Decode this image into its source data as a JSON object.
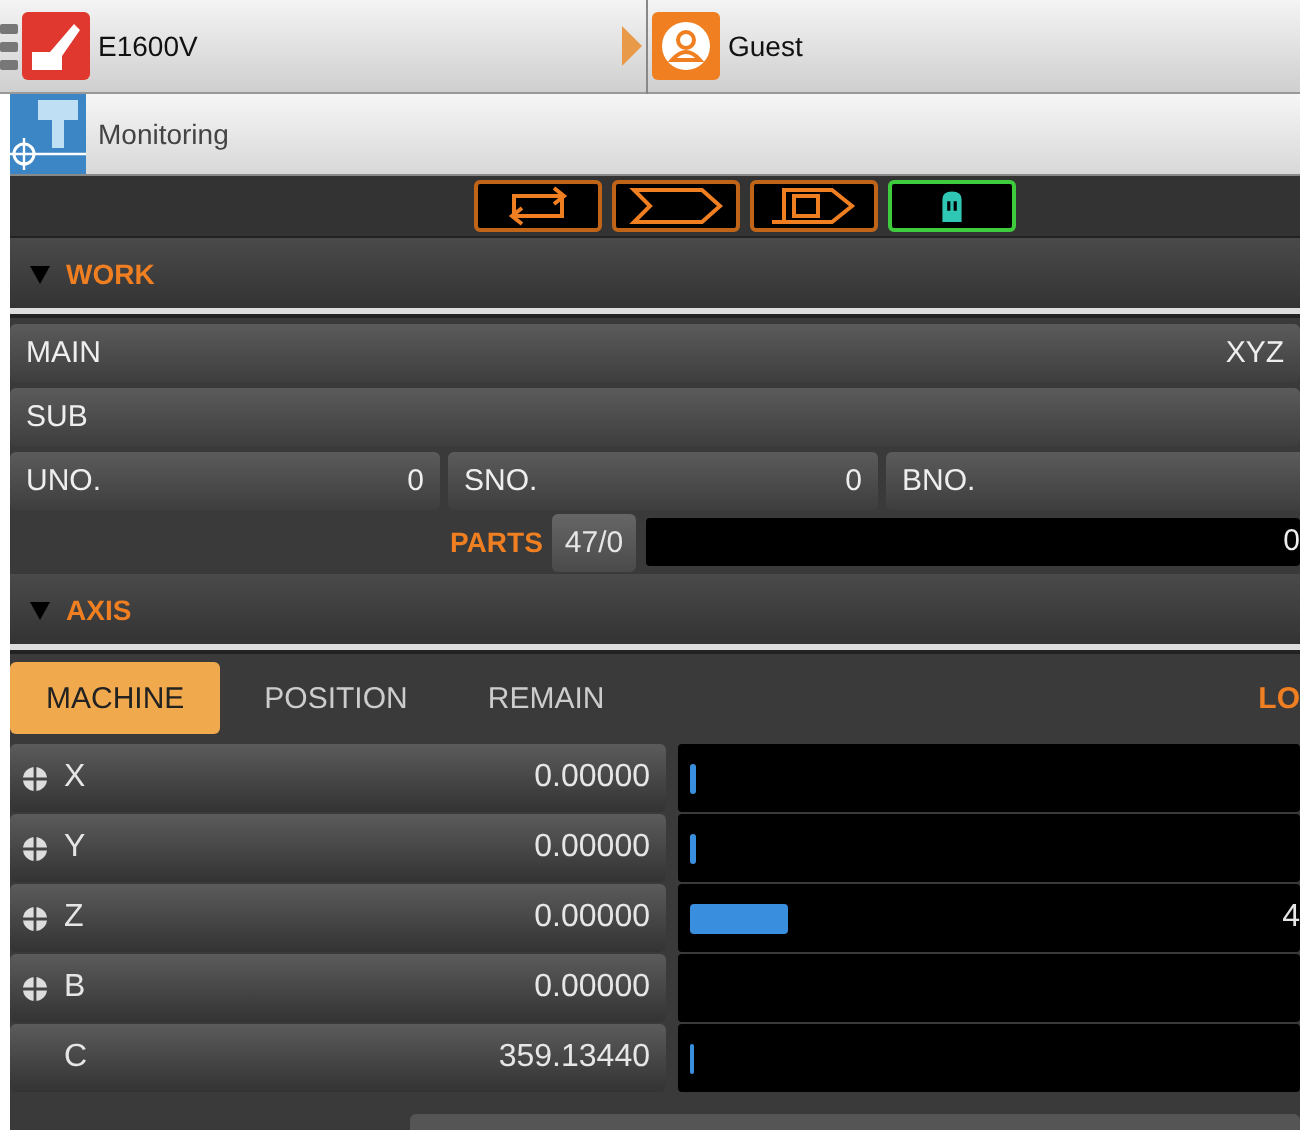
{
  "header": {
    "machine": "E1600V",
    "user": "Guest"
  },
  "screen": {
    "title": "Monitoring"
  },
  "mode_buttons": [
    {
      "kind": "cycle",
      "selected": false
    },
    {
      "kind": "arrow",
      "selected": false
    },
    {
      "kind": "program",
      "selected": false
    },
    {
      "kind": "hand",
      "selected": true
    }
  ],
  "work": {
    "title": "WORK",
    "main": {
      "label": "MAIN",
      "value": "XYZ"
    },
    "sub": {
      "label": "SUB"
    },
    "counters": [
      {
        "label": "UNO.",
        "value": "0"
      },
      {
        "label": "SNO.",
        "value": "0"
      },
      {
        "label": "BNO."
      }
    ],
    "parts": {
      "label": "PARTS",
      "value": "47/0",
      "reading": "0"
    }
  },
  "axis": {
    "title": "AXIS",
    "side_label": "LO",
    "tabs": [
      {
        "label": "MACHINE",
        "selected": true
      },
      {
        "label": "POSITION",
        "selected": false
      },
      {
        "label": "REMAIN",
        "selected": false
      }
    ],
    "rows": [
      {
        "name": "X",
        "rotary": false,
        "value": "0.00000",
        "level": 0.01
      },
      {
        "name": "Y",
        "rotary": false,
        "value": "0.00000",
        "level": 0.01
      },
      {
        "name": "Z",
        "rotary": false,
        "value": "0.00000",
        "level": 0.16,
        "reading": "4"
      },
      {
        "name": "B",
        "rotary": false,
        "value": "0.00000"
      },
      {
        "name": "C",
        "rotary": true,
        "value": "359.13440",
        "level": 0.005
      }
    ]
  }
}
